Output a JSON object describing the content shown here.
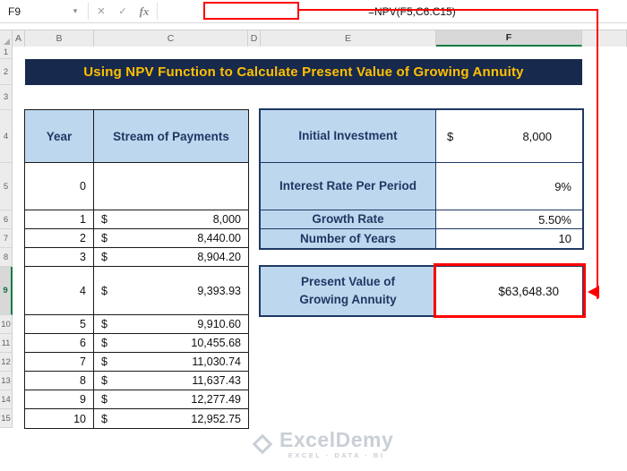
{
  "formula_bar": {
    "name_box_value": "F9",
    "formula": "=NPV(F5,C6:C15)"
  },
  "icons": {
    "name_box_caret": "▾",
    "cancel": "✕",
    "enter": "✓",
    "fx": "fx"
  },
  "grid": {
    "column_headers": [
      "A",
      "B",
      "C",
      "D",
      "E",
      "F"
    ],
    "row_headers": [
      "1",
      "2",
      "3",
      "4",
      "5",
      "6",
      "7",
      "8",
      "9",
      "10",
      "11",
      "12",
      "13",
      "14",
      "15"
    ],
    "selected_cell": "F9"
  },
  "banner": {
    "title": "Using NPV Function to Calculate Present Value of Growing Annuity"
  },
  "payments_table": {
    "header": {
      "year": "Year",
      "payments": "Stream of Payments"
    },
    "rows": [
      {
        "year": "0",
        "currency": "",
        "amount": ""
      },
      {
        "year": "1",
        "currency": "$",
        "amount": "8,000"
      },
      {
        "year": "2",
        "currency": "$",
        "amount": "8,440.00"
      },
      {
        "year": "3",
        "currency": "$",
        "amount": "8,904.20"
      },
      {
        "year": "4",
        "currency": "$",
        "amount": "9,393.93"
      },
      {
        "year": "5",
        "currency": "$",
        "amount": "9,910.60"
      },
      {
        "year": "6",
        "currency": "$",
        "amount": "10,455.68"
      },
      {
        "year": "7",
        "currency": "$",
        "amount": "11,030.74"
      },
      {
        "year": "8",
        "currency": "$",
        "amount": "11,637.43"
      },
      {
        "year": "9",
        "currency": "$",
        "amount": "12,277.49"
      },
      {
        "year": "10",
        "currency": "$",
        "amount": "12,952.75"
      }
    ]
  },
  "inputs_table": {
    "rows": [
      {
        "label": "Initial Investment",
        "currency": "$",
        "value": "8,000"
      },
      {
        "label": "Interest Rate Per Period",
        "currency": "",
        "value": "9%"
      },
      {
        "label": "Growth Rate",
        "currency": "",
        "value": "5.50%"
      },
      {
        "label": "Number of Years",
        "currency": "",
        "value": "10"
      }
    ]
  },
  "result": {
    "label": "Present Value of Growing Annuity",
    "value": "$63,648.30"
  },
  "watermark": {
    "name": "ExcelDemy",
    "tagline": "EXCEL · DATA · BI"
  },
  "colors": {
    "banner_bg": "#17294D",
    "banner_text": "#FFC000",
    "header_fill": "#BDD7EE",
    "label_text": "#1F3864",
    "table_border_dark": "#1F3864",
    "annotation_red": "#FF0000",
    "selection_green": "#107C41"
  }
}
